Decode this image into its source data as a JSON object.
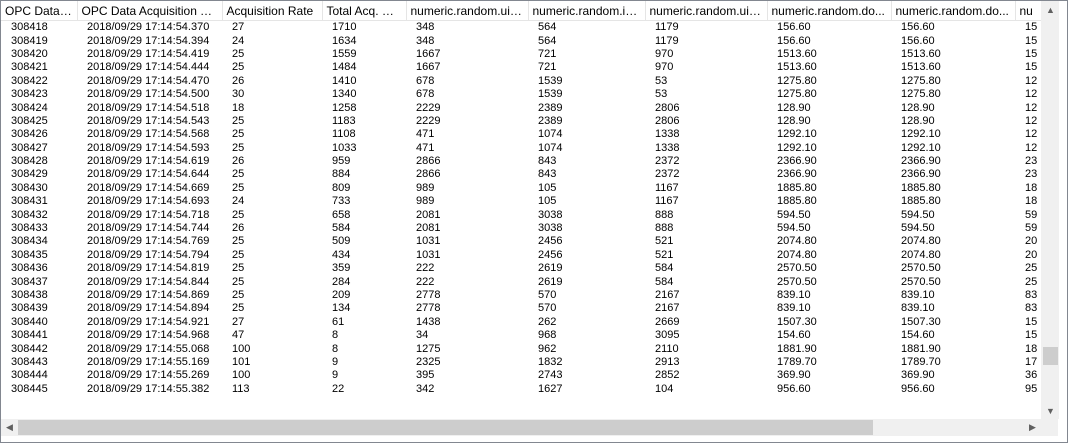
{
  "grid": {
    "columns": [
      "OPC Data Id",
      "OPC Data Acquisition Ti...",
      "Acquisition Rate",
      "Total Acq. Gap",
      "numeric.random.uin...",
      "numeric.random.in...",
      "numeric.random.uin...",
      "numeric.random.do...",
      "numeric.random.do...",
      "nu"
    ],
    "rows": [
      [
        "308418",
        "2018/09/29 17:14:54.370",
        "27",
        "1710",
        "348",
        "564",
        "1179",
        "156.60",
        "156.60",
        "15"
      ],
      [
        "308419",
        "2018/09/29 17:14:54.394",
        "24",
        "1634",
        "348",
        "564",
        "1179",
        "156.60",
        "156.60",
        "15"
      ],
      [
        "308420",
        "2018/09/29 17:14:54.419",
        "25",
        "1559",
        "1667",
        "721",
        "970",
        "1513.60",
        "1513.60",
        "15"
      ],
      [
        "308421",
        "2018/09/29 17:14:54.444",
        "25",
        "1484",
        "1667",
        "721",
        "970",
        "1513.60",
        "1513.60",
        "15"
      ],
      [
        "308422",
        "2018/09/29 17:14:54.470",
        "26",
        "1410",
        "678",
        "1539",
        "53",
        "1275.80",
        "1275.80",
        "12"
      ],
      [
        "308423",
        "2018/09/29 17:14:54.500",
        "30",
        "1340",
        "678",
        "1539",
        "53",
        "1275.80",
        "1275.80",
        "12"
      ],
      [
        "308424",
        "2018/09/29 17:14:54.518",
        "18",
        "1258",
        "2229",
        "2389",
        "2806",
        "128.90",
        "128.90",
        "12"
      ],
      [
        "308425",
        "2018/09/29 17:14:54.543",
        "25",
        "1183",
        "2229",
        "2389",
        "2806",
        "128.90",
        "128.90",
        "12"
      ],
      [
        "308426",
        "2018/09/29 17:14:54.568",
        "25",
        "1108",
        "471",
        "1074",
        "1338",
        "1292.10",
        "1292.10",
        "12"
      ],
      [
        "308427",
        "2018/09/29 17:14:54.593",
        "25",
        "1033",
        "471",
        "1074",
        "1338",
        "1292.10",
        "1292.10",
        "12"
      ],
      [
        "308428",
        "2018/09/29 17:14:54.619",
        "26",
        "959",
        "2866",
        "843",
        "2372",
        "2366.90",
        "2366.90",
        "23"
      ],
      [
        "308429",
        "2018/09/29 17:14:54.644",
        "25",
        "884",
        "2866",
        "843",
        "2372",
        "2366.90",
        "2366.90",
        "23"
      ],
      [
        "308430",
        "2018/09/29 17:14:54.669",
        "25",
        "809",
        "989",
        "105",
        "1167",
        "1885.80",
        "1885.80",
        "18"
      ],
      [
        "308431",
        "2018/09/29 17:14:54.693",
        "24",
        "733",
        "989",
        "105",
        "1167",
        "1885.80",
        "1885.80",
        "18"
      ],
      [
        "308432",
        "2018/09/29 17:14:54.718",
        "25",
        "658",
        "2081",
        "3038",
        "888",
        "594.50",
        "594.50",
        "59"
      ],
      [
        "308433",
        "2018/09/29 17:14:54.744",
        "26",
        "584",
        "2081",
        "3038",
        "888",
        "594.50",
        "594.50",
        "59"
      ],
      [
        "308434",
        "2018/09/29 17:14:54.769",
        "25",
        "509",
        "1031",
        "2456",
        "521",
        "2074.80",
        "2074.80",
        "20"
      ],
      [
        "308435",
        "2018/09/29 17:14:54.794",
        "25",
        "434",
        "1031",
        "2456",
        "521",
        "2074.80",
        "2074.80",
        "20"
      ],
      [
        "308436",
        "2018/09/29 17:14:54.819",
        "25",
        "359",
        "222",
        "2619",
        "584",
        "2570.50",
        "2570.50",
        "25"
      ],
      [
        "308437",
        "2018/09/29 17:14:54.844",
        "25",
        "284",
        "222",
        "2619",
        "584",
        "2570.50",
        "2570.50",
        "25"
      ],
      [
        "308438",
        "2018/09/29 17:14:54.869",
        "25",
        "209",
        "2778",
        "570",
        "2167",
        "839.10",
        "839.10",
        "83"
      ],
      [
        "308439",
        "2018/09/29 17:14:54.894",
        "25",
        "134",
        "2778",
        "570",
        "2167",
        "839.10",
        "839.10",
        "83"
      ],
      [
        "308440",
        "2018/09/29 17:14:54.921",
        "27",
        "61",
        "1438",
        "262",
        "2669",
        "1507.30",
        "1507.30",
        "15"
      ],
      [
        "308441",
        "2018/09/29 17:14:54.968",
        "47",
        "8",
        "34",
        "968",
        "3095",
        "154.60",
        "154.60",
        "15"
      ],
      [
        "308442",
        "2018/09/29 17:14:55.068",
        "100",
        "8",
        "1275",
        "962",
        "2110",
        "1881.90",
        "1881.90",
        "18"
      ],
      [
        "308443",
        "2018/09/29 17:14:55.169",
        "101",
        "9",
        "2325",
        "1832",
        "2913",
        "1789.70",
        "1789.70",
        "17"
      ],
      [
        "308444",
        "2018/09/29 17:14:55.269",
        "100",
        "9",
        "395",
        "2743",
        "2852",
        "369.90",
        "369.90",
        "36"
      ],
      [
        "308445",
        "2018/09/29 17:14:55.382",
        "113",
        "22",
        "342",
        "1627",
        "104",
        "956.60",
        "956.60",
        "95"
      ]
    ]
  },
  "scrollbars": {
    "up_arrow_icon": "chevron-up-icon",
    "down_arrow_icon": "chevron-down-icon",
    "left_arrow_icon": "chevron-left-icon",
    "right_arrow_icon": "chevron-right-icon",
    "vertical_position": 0.9,
    "horizontal_position": 0.0,
    "horizontal_visible_fraction": 0.85
  },
  "colors": {
    "header_border": "#e5e5e5",
    "scroll_track": "#f0f0f0",
    "scroll_thumb": "#cdcdcd",
    "frame_border": "#828790"
  }
}
